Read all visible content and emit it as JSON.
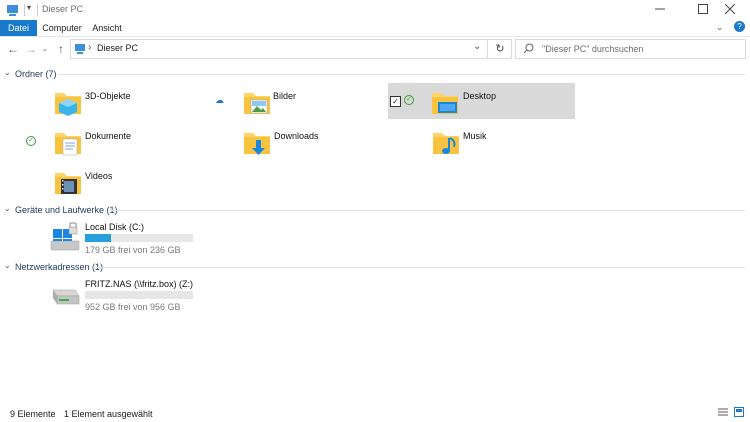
{
  "window": {
    "title": "Dieser PC",
    "minimize_icon": "minimize-icon",
    "maximize_icon": "maximize-icon",
    "close_icon": "close-icon"
  },
  "ribbon": {
    "tabs": [
      {
        "label": "Datei",
        "active": true
      },
      {
        "label": "Computer",
        "active": false
      },
      {
        "label": "Ansicht",
        "active": false
      }
    ]
  },
  "address": {
    "path": "Dieser PC",
    "search_placeholder": "\"Dieser PC\" durchsuchen"
  },
  "groups": {
    "folders": {
      "header": "Ordner (7)",
      "items": [
        {
          "label": "3D-Objekte",
          "icon": "3d-objects-folder-icon"
        },
        {
          "label": "Bilder",
          "icon": "pictures-folder-icon",
          "sync": "cloud"
        },
        {
          "label": "Desktop",
          "icon": "desktop-folder-icon",
          "sync": "check",
          "selected": true
        },
        {
          "label": "Dokumente",
          "icon": "documents-folder-icon",
          "sync": "check"
        },
        {
          "label": "Downloads",
          "icon": "downloads-folder-icon"
        },
        {
          "label": "Musik",
          "icon": "music-folder-icon"
        },
        {
          "label": "Videos",
          "icon": "videos-folder-icon"
        }
      ]
    },
    "drives": {
      "header": "Geräte und Laufwerke (1)",
      "items": [
        {
          "label": "Local Disk (C:)",
          "subtext": "179 GB frei von 236 GB",
          "used_fraction": 0.24,
          "icon": "local-disk-icon"
        }
      ]
    },
    "network": {
      "header": "Netzwerkadressen (1)",
      "items": [
        {
          "label": "FRITZ.NAS (\\\\fritz.box) (Z:)",
          "subtext": "952 GB frei von 956 GB",
          "used_fraction": 0.0,
          "icon": "network-drive-icon"
        }
      ]
    }
  },
  "status": {
    "count": "9 Elemente",
    "selection": "1 Element ausgewählt"
  },
  "colors": {
    "accent": "#1979ca",
    "selection": "#cce8ff",
    "progress": "#26a0da",
    "folder": "#ffd466"
  }
}
